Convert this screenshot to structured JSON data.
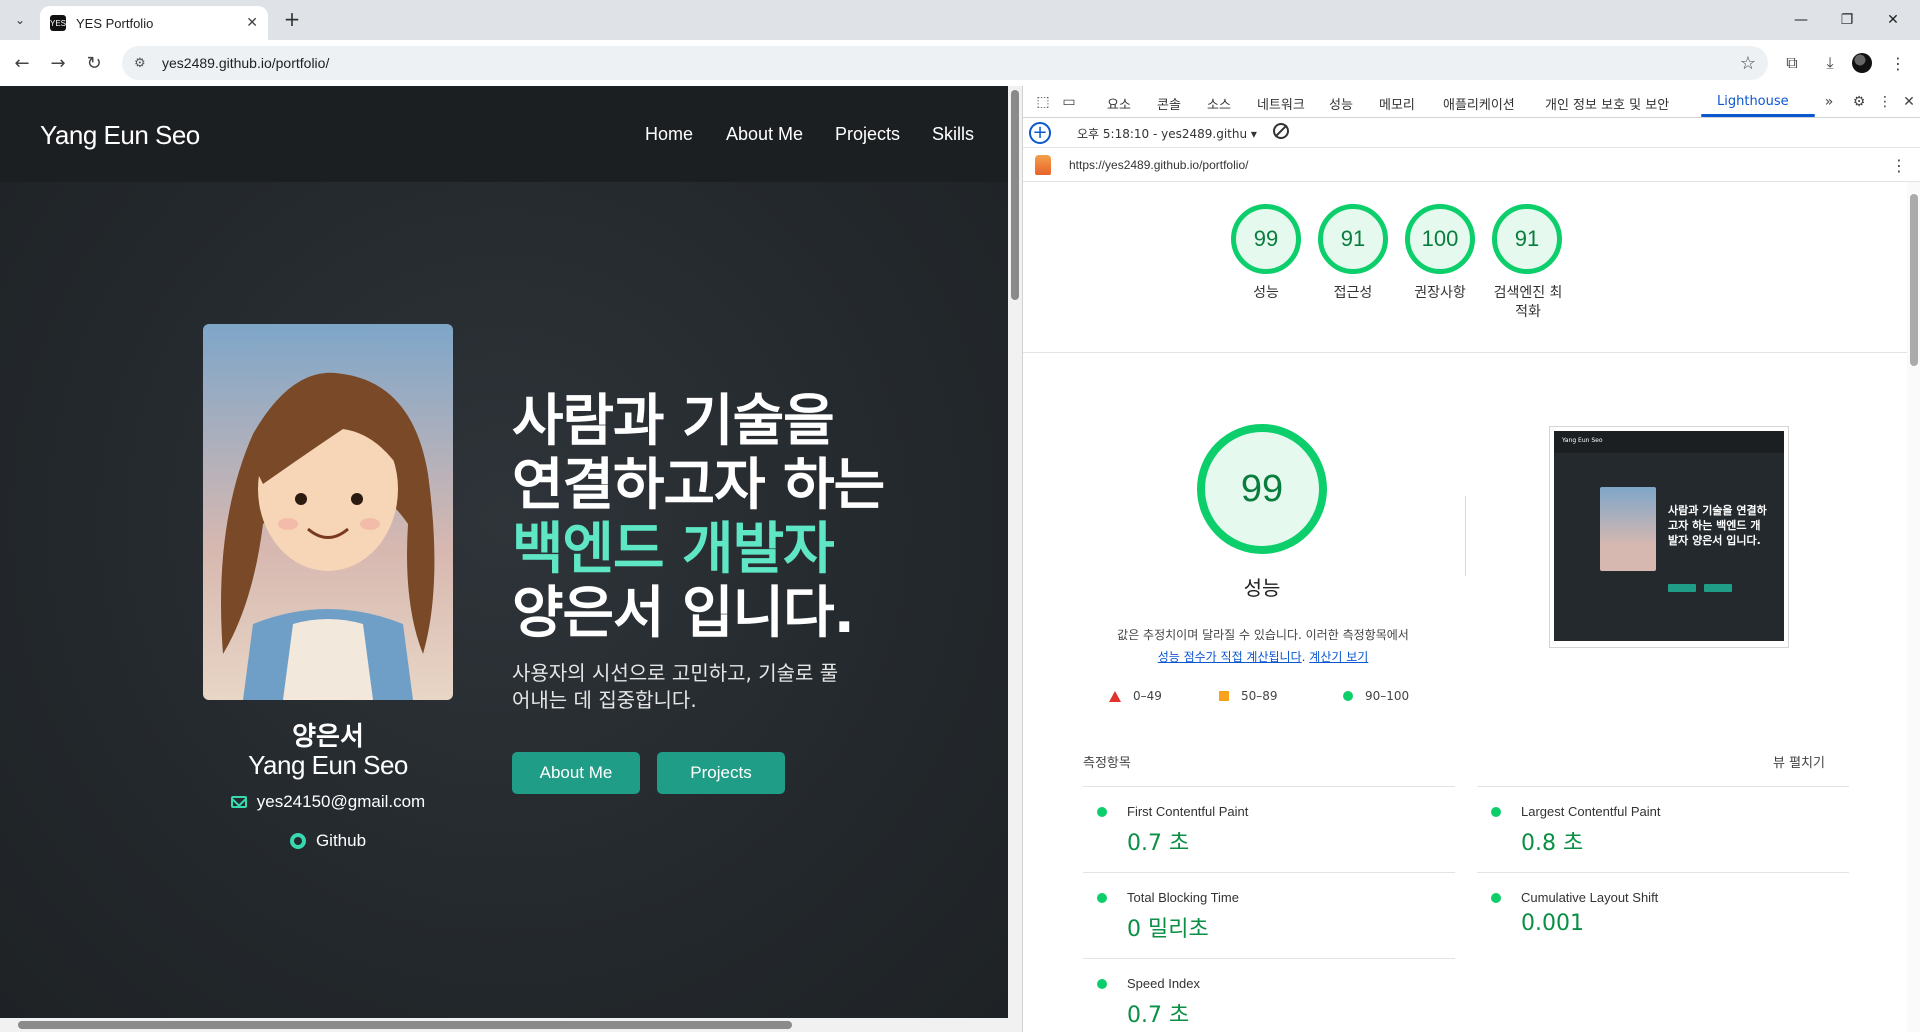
{
  "browser": {
    "tab_title": "YES Portfolio",
    "url": "yes2489.github.io/portfolio/"
  },
  "site": {
    "brand": "Yang Eun Seo",
    "nav": [
      "Home",
      "About Me",
      "Projects",
      "Skills"
    ],
    "profile_name_ko": "양은서",
    "profile_name_en": "Yang Eun Seo",
    "email": "yes24150@gmail.com",
    "github": "Github",
    "hero_line1": "사람과 기술을",
    "hero_line2": "연결하고자 하는",
    "hero_line3": "백엔드 개발자",
    "hero_line4": "양은서 입니다.",
    "hero_sub": "사용자의 시선으로 고민하고, 기술로 풀어내는 데 집중합니다.",
    "btn_about": "About Me",
    "btn_projects": "Projects",
    "accent_color": "#5ee6c5",
    "button_color": "#1f9d86"
  },
  "devtools": {
    "tabs": [
      "요소",
      "콘솔",
      "소스",
      "네트워크",
      "성능",
      "메모리",
      "애플리케이션",
      "개인 정보 보호 및 보안",
      "Lighthouse"
    ],
    "active_tab": "Lighthouse",
    "report_selector": "오후 5:18:10 - yes2489.githu",
    "report_url": "https://yes2489.github.io/portfolio/",
    "scores": [
      {
        "value": "99",
        "label": "성능"
      },
      {
        "value": "91",
        "label": "접근성"
      },
      {
        "value": "100",
        "label": "권장사항"
      },
      {
        "value": "91",
        "label": "검색엔진 최적화"
      }
    ],
    "perf_score": "99",
    "perf_label": "성능",
    "perf_desc": "값은 추정치이며 달라질 수 있습니다. 이러한 측정항목에서",
    "perf_link1": "성능 점수가 직접 계산됩니다",
    "perf_link2": "계산기 보기",
    "legend": [
      "0–49",
      "50–89",
      "90–100"
    ],
    "thumb": {
      "brand": "Yang Eun Seo",
      "text": "사람과 기술을 연결하고자 하는 백엔드 개발자 양은서 입니다."
    },
    "metrics_title": "측정항목",
    "metrics_expand": "뷰 펼치기",
    "metrics": [
      {
        "name": "First Contentful Paint",
        "value": "0.7 초"
      },
      {
        "name": "Largest Contentful Paint",
        "value": "0.8 초"
      },
      {
        "name": "Total Blocking Time",
        "value": "0 밀리초"
      },
      {
        "name": "Cumulative Layout Shift",
        "value": "0.001"
      },
      {
        "name": "Speed Index",
        "value": "0.7 초"
      }
    ],
    "pass_color": "#0cce6b"
  }
}
